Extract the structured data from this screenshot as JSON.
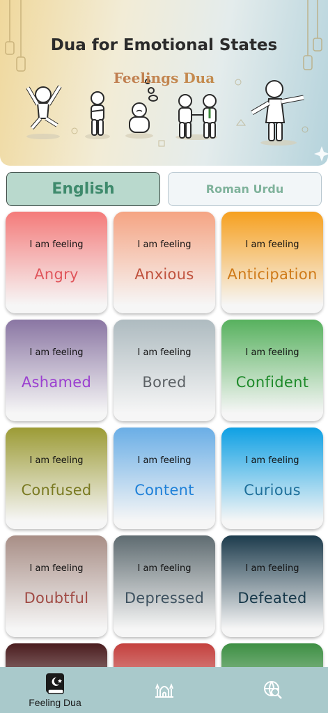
{
  "header": {
    "title": "Dua for Emotional States",
    "subtitle": "Feelings Dua"
  },
  "language_tabs": [
    {
      "label": "English",
      "selected": true
    },
    {
      "label": "Roman Urdu",
      "selected": false
    }
  ],
  "cards": [
    {
      "prefix": "I am feeling",
      "feeling": "Angry",
      "top": "#f47b7a",
      "text": "#e0555b"
    },
    {
      "prefix": "I am feeling",
      "feeling": "Anxious",
      "top": "#f5a483",
      "text": "#c0513c"
    },
    {
      "prefix": "I am feeling",
      "feeling": "Anticipation",
      "top": "#f6a01f",
      "text": "#cf7a18"
    },
    {
      "prefix": "I am feeling",
      "feeling": "Ashamed",
      "top": "#8a76a3",
      "text": "#9b40d0"
    },
    {
      "prefix": "I am feeling",
      "feeling": "Bored",
      "top": "#aebbc0",
      "text": "#5c6165"
    },
    {
      "prefix": "I am feeling",
      "feeling": "Confident",
      "top": "#57b15e",
      "text": "#1e8a2a"
    },
    {
      "prefix": "I am feeling",
      "feeling": "Confused",
      "top": "#9c9b35",
      "text": "#7a7a22"
    },
    {
      "prefix": "I am feeling",
      "feeling": "Content",
      "top": "#6aaee6",
      "text": "#1e80d8"
    },
    {
      "prefix": "I am feeling",
      "feeling": "Curious",
      "top": "#0ea0e4",
      "text": "#1d6f9a"
    },
    {
      "prefix": "I am feeling",
      "feeling": "Doubtful",
      "top": "#a88e86",
      "text": "#a04a44"
    },
    {
      "prefix": "I am feeling",
      "feeling": "Depressed",
      "top": "#5e6b70",
      "text": "#3e5260"
    },
    {
      "prefix": "I am feeling",
      "feeling": "Defeated",
      "top": "#1c3b4c",
      "text": "#17384a"
    },
    {
      "prefix": "",
      "feeling": "",
      "top": "#4a1c1e",
      "text": "#4a1c1e"
    },
    {
      "prefix": "",
      "feeling": "",
      "top": "#c4403d",
      "text": "#c4403d"
    },
    {
      "prefix": "",
      "feeling": "",
      "top": "#3d8f43",
      "text": "#3d8f43"
    }
  ],
  "bottom_nav": [
    {
      "label": "Feeling Dua",
      "icon": "book-icon",
      "active": true
    },
    {
      "label": "",
      "icon": "mosque-icon",
      "active": false
    },
    {
      "label": "",
      "icon": "globe-search-icon",
      "active": false
    }
  ]
}
